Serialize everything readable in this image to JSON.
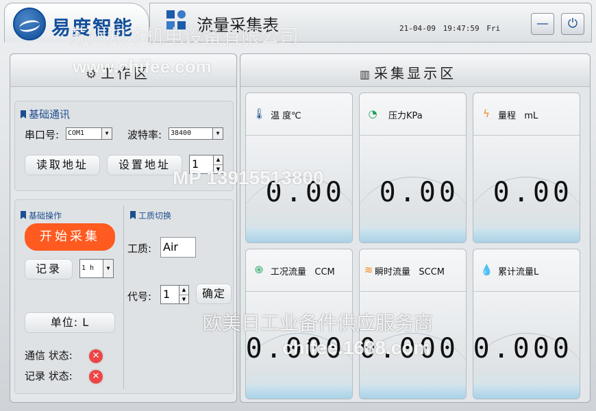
{
  "header": {
    "brand": "易度智能",
    "title": "流量采集表",
    "datetime": "21-04-09  19:47:59  Fri"
  },
  "window_buttons": {
    "minimize": "—",
    "power": "⏻"
  },
  "watermarks": {
    "company": "苏州知才机电设备有限公司",
    "site": "www.chifee.com",
    "phone": "MP 13915513800",
    "service": "欧美日工业备件供应服务商",
    "shop": "chifee.1688.com"
  },
  "work_panel": {
    "title": "工作区",
    "comm": {
      "section_label": "基础通讯",
      "port_label": "串口号:",
      "port_value": "COM1",
      "baud_label": "波特率:",
      "baud_value": "38400",
      "read_button": "读取地址",
      "set_button": "设置地址",
      "address_value": "1"
    },
    "ops": {
      "section_label": "基础操作",
      "start_button": "开始采集",
      "record_button": "记录",
      "record_interval": "1 h",
      "unit_button": "单位: L",
      "comm_status_label": "通信 状态:",
      "record_status_label": "记录 状态:"
    },
    "medium": {
      "section_label": "工质切换",
      "medium_label": "工质:",
      "medium_value": "Air",
      "code_label": "代号:",
      "code_value": "1",
      "confirm_button": "确定"
    }
  },
  "display_panel": {
    "title": "采集显示区",
    "cards": [
      {
        "label": "温 度℃",
        "value": "0.00",
        "icon": "thermometer-icon",
        "color": "#1d4f8f"
      },
      {
        "label": "压力KPa",
        "value": "0.00",
        "icon": "gauge-icon",
        "color": "#1aa05a"
      },
      {
        "label": "量程   mL",
        "value": "0.00",
        "icon": "bolt-icon",
        "color": "#f08a1c"
      },
      {
        "label": "工况流量   CCM",
        "value": "0.000",
        "icon": "flow-swirl-icon",
        "color": "#1aa05a"
      },
      {
        "label": "瞬时流量   SCCM",
        "value": "0.000",
        "icon": "wave-icon",
        "color": "#f08a1c"
      },
      {
        "label": "累计流量L",
        "value": "0.000",
        "icon": "drop-icon",
        "color": "#1d6fc8"
      }
    ]
  }
}
